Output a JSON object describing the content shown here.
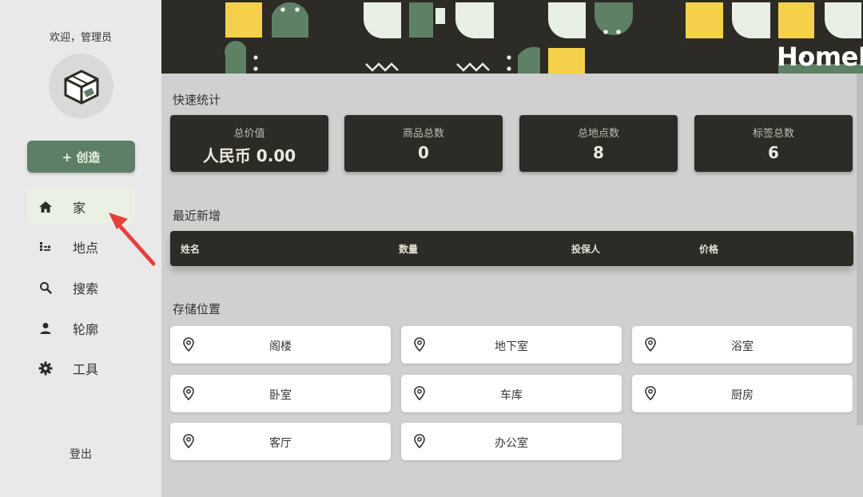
{
  "sidebar": {
    "welcome": "欢迎，管理员",
    "create_label": "+ 创造",
    "items": [
      {
        "label": "家",
        "icon": "home-icon",
        "active": true
      },
      {
        "label": "地点",
        "icon": "locations-tree-icon"
      },
      {
        "label": "搜索",
        "icon": "search-icon"
      },
      {
        "label": "轮廓",
        "icon": "profile-icon"
      },
      {
        "label": "工具",
        "icon": "gear-icon"
      }
    ],
    "logout": "登出"
  },
  "header": {
    "logo": "HomeBox"
  },
  "stats": {
    "title": "快速统计",
    "items": [
      {
        "label": "总价值",
        "value": "人民币 0.00"
      },
      {
        "label": "商品总数",
        "value": "0"
      },
      {
        "label": "总地点数",
        "value": "8"
      },
      {
        "label": "标签总数",
        "value": "6"
      }
    ]
  },
  "recent": {
    "title": "最近新增",
    "columns": [
      "姓名",
      "数量",
      "投保人",
      "价格"
    ]
  },
  "storage": {
    "title": "存储位置",
    "locations": [
      "阁楼",
      "地下室",
      "浴室",
      "卧室",
      "车库",
      "厨房",
      "客厅",
      "办公室"
    ]
  },
  "colors": {
    "accent": "#5d7f67",
    "dark": "#2c2b25",
    "banner_yellow": "#f5d04a",
    "banner_green": "#5e8064",
    "banner_white": "#e8efe5"
  }
}
